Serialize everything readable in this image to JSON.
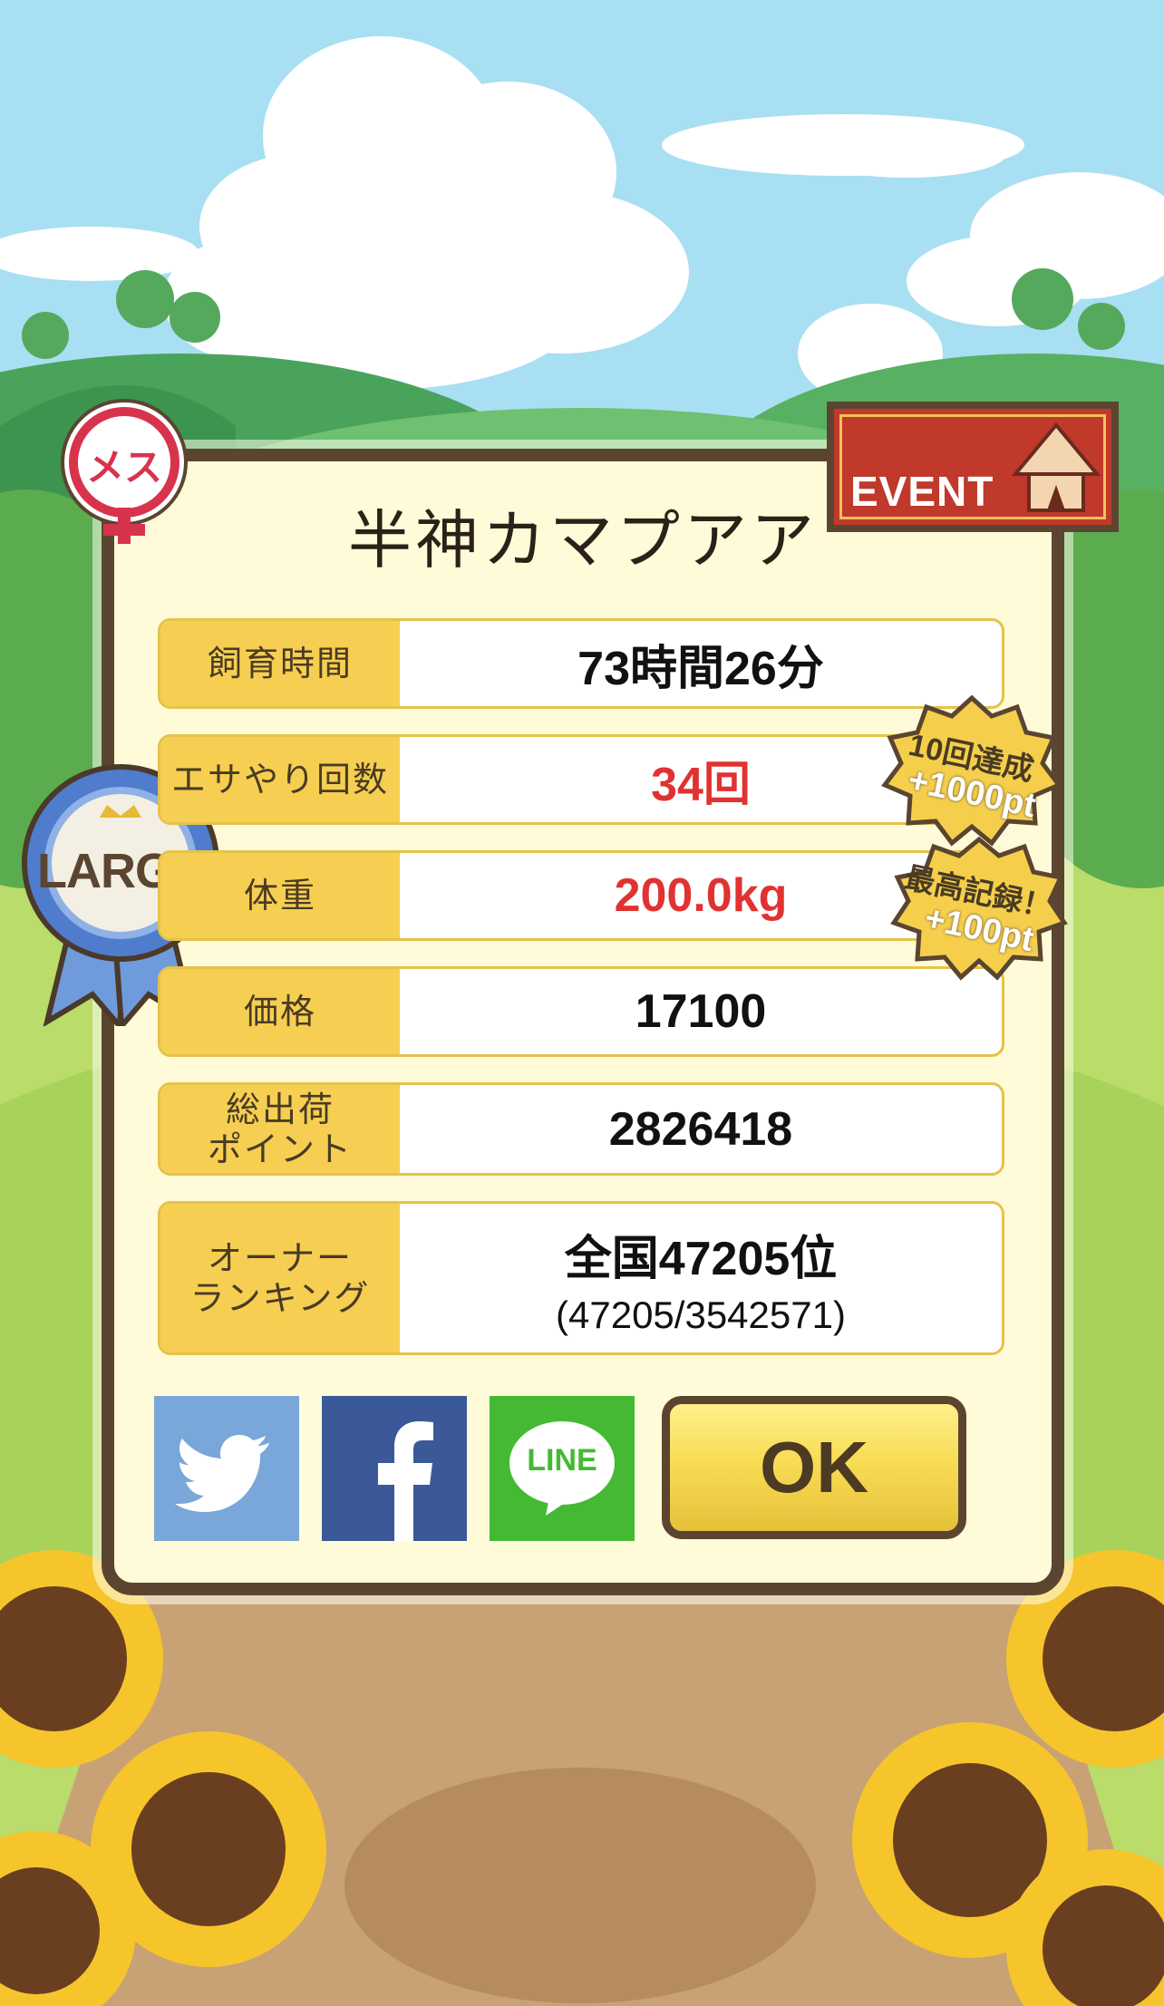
{
  "pig": {
    "gender_label": "メス",
    "name": "半神カマプアア",
    "size_label": "LARGE"
  },
  "event_label": "EVENT",
  "stats": [
    {
      "label": "飼育時間",
      "value": "73時間26分"
    },
    {
      "label": "エサやり回数",
      "value": "34回"
    },
    {
      "label": "体重",
      "value": "200.0kg"
    },
    {
      "label": "価格",
      "value": "17100"
    },
    {
      "label": "総出荷\nポイント",
      "value": "2826418"
    },
    {
      "label": "オーナー\nランキング",
      "value": "全国47205位",
      "sub": "(47205/3542571)"
    }
  ],
  "bonus_badges": [
    {
      "line1": "10回達成",
      "line2": "+1000pt"
    },
    {
      "line1": "最高記録！",
      "line2": "+100pt"
    }
  ],
  "share": {
    "twitter_icon": "twitter-bird-icon",
    "facebook_icon": "facebook-f-icon",
    "line_label": "LINE"
  },
  "ok_label": "OK",
  "colors": {
    "twitter": "#79a7d9",
    "facebook": "#3b5998",
    "line": "#45b934",
    "accent_red": "#e13232",
    "label_yellow": "#f6cf52"
  }
}
